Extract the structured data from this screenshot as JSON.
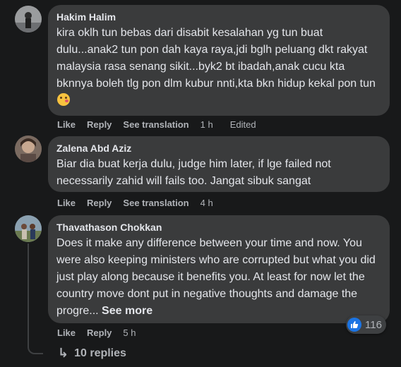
{
  "comments": [
    {
      "author": "Hakim Halim",
      "text": "kira oklh tun bebas dari disabit kesalahan yg tun buat dulu...anak2 tun pon dah kaya raya,jdi bglh peluang dkt rakyat malaysia rasa senang sikit...byk2 bt ibadah,anak cucu kta bknnya boleh tlg pon dlm kubur nnti,kta bkn hidup kekal pon tun",
      "emoji": "face-blowing-kiss-icon",
      "like": "Like",
      "reply": "Reply",
      "translate": "See translation",
      "time": "1 h",
      "edited": "Edited"
    },
    {
      "author": "Zalena Abd Aziz",
      "text": "Biar dia buat kerja dulu, judge him later, if lge failed not necessarily zahid will fails too. Jangat sibuk sangat",
      "like": "Like",
      "reply": "Reply",
      "translate": "See translation",
      "time": "4 h"
    },
    {
      "author": "Thavathason Chokkan",
      "text": "Does it make any difference between your time and now. You were also keeping ministers who are corrupted but what you did just play along because it benefits you. At least for now let the country move dont put in negative thoughts and damage the progre...",
      "see_more": "See more",
      "like": "Like",
      "reply": "Reply",
      "time": "5 h",
      "reaction_count": "116"
    }
  ],
  "replies_link": "10 replies",
  "colors": {
    "background": "#18191a",
    "bubble": "#3a3b3c",
    "text": "#e4e6eb",
    "muted": "#b0b3b8",
    "like_blue": "#1b74e4"
  }
}
